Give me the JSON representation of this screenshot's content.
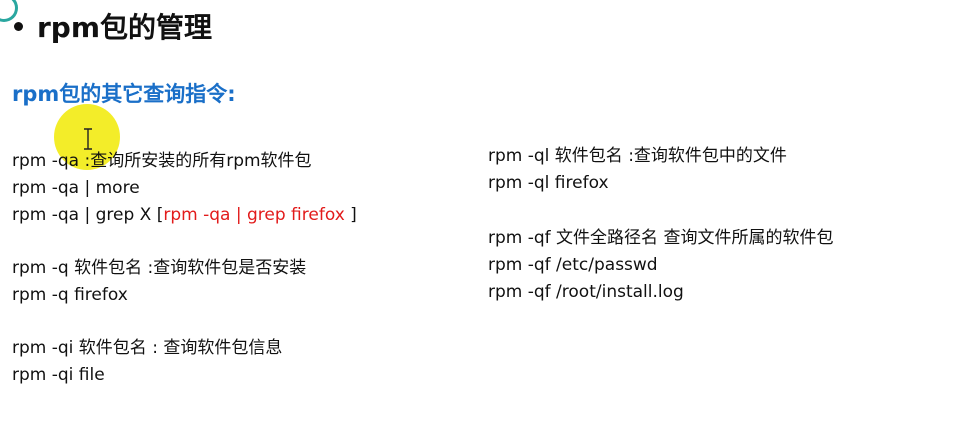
{
  "heading": {
    "title": "rpm包的管理"
  },
  "subheading": "rpm包的其它查询指令:",
  "left_column": {
    "g1": [
      "rpm -qa :查询所安装的所有rpm软件包",
      "rpm -qa | more"
    ],
    "g1_line3_prefix": "rpm -qa | grep X [",
    "g1_line3_red": "rpm -qa | grep firefox",
    "g1_line3_suffix": " ]",
    "g2": [
      "rpm -q 软件包名 :查询软件包是否安装",
      "rpm -q firefox"
    ],
    "g3": [
      "rpm -qi 软件包名 : 查询软件包信息",
      "rpm -qi file"
    ]
  },
  "right_column": {
    "g1": [
      "rpm -ql 软件包名 :查询软件包中的文件",
      "rpm -ql firefox"
    ],
    "g2": [
      "rpm -qf 文件全路径名 查询文件所属的软件包",
      "rpm -qf /etc/passwd",
      "rpm -qf /root/install.log"
    ]
  },
  "colors": {
    "subheading": "#1a6fc8",
    "highlight_text": "#e21b1b",
    "cursor_highlight": "#f2ec1e"
  }
}
